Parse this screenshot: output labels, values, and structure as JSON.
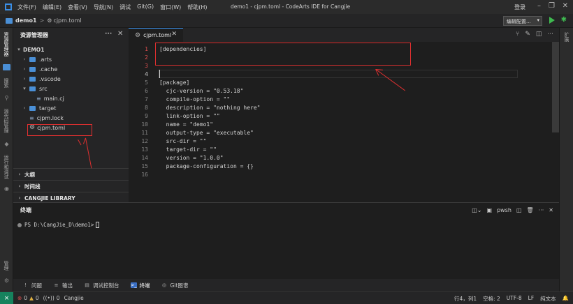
{
  "menu": [
    "文件(F)",
    "编辑(E)",
    "查看(V)",
    "导航(N)",
    "调试",
    "Git(G)",
    "窗口(W)",
    "帮助(H)"
  ],
  "window_title": "demo1 - cjpm.toml - CodeArts IDE for Cangjie",
  "login": "登录",
  "breadcrumb": {
    "project": "demo1",
    "separator": ">",
    "file": "cjpm.toml"
  },
  "toolbar": {
    "config_select": "编辑配置...",
    "run_icon": "play-icon",
    "debug_icon": "bug-icon"
  },
  "activity": {
    "explorer": "资源管理器",
    "search": "搜索",
    "source_control": "源代码管理",
    "run_debug": "运行和调试",
    "manage": "管理"
  },
  "rightbar": {
    "extensions": "扩展"
  },
  "sidebar": {
    "title": "资源管理器",
    "more": "···",
    "root": "DEMO1",
    "tree": [
      {
        "label": ".arts",
        "type": "folder",
        "expanded": false,
        "indent": 1
      },
      {
        "label": ".cache",
        "type": "folder",
        "expanded": false,
        "indent": 1
      },
      {
        "label": ".vscode",
        "type": "folder",
        "expanded": false,
        "indent": 1
      },
      {
        "label": "src",
        "type": "folder",
        "expanded": true,
        "indent": 1
      },
      {
        "label": "main.cj",
        "type": "file",
        "indent": 2
      },
      {
        "label": "target",
        "type": "folder",
        "expanded": false,
        "indent": 1
      },
      {
        "label": "cjpm.lock",
        "type": "file",
        "indent": 1
      },
      {
        "label": "cjpm.toml",
        "type": "gear-file",
        "indent": 1
      }
    ],
    "sections": [
      "大纲",
      "时间线",
      "CANGJIE LIBRARY"
    ]
  },
  "editor": {
    "tab": "cjpm.toml",
    "lines": [
      {
        "n": "1",
        "text": "[dependencies]",
        "err": true
      },
      {
        "n": "2",
        "text": "",
        "err": true
      },
      {
        "n": "3",
        "text": "",
        "err": true
      },
      {
        "n": "4",
        "text": "",
        "cur": true
      },
      {
        "n": "5",
        "text": "[package]"
      },
      {
        "n": "6",
        "text": "  cjc-version = \"0.53.18\""
      },
      {
        "n": "7",
        "text": "  compile-option = \"\""
      },
      {
        "n": "8",
        "text": "  description = \"nothing here\""
      },
      {
        "n": "9",
        "text": "  link-option = \"\""
      },
      {
        "n": "10",
        "text": "  name = \"demo1\""
      },
      {
        "n": "11",
        "text": "  output-type = \"executable\""
      },
      {
        "n": "12",
        "text": "  src-dir = \"\""
      },
      {
        "n": "13",
        "text": "  target-dir = \"\""
      },
      {
        "n": "14",
        "text": "  version = \"1.0.0\""
      },
      {
        "n": "15",
        "text": "  package-configuration = {}"
      },
      {
        "n": "16",
        "text": ""
      }
    ]
  },
  "panel": {
    "title": "终端",
    "shell": "pwsh",
    "prompt": "PS D:\\CangJie_D\\demo1> "
  },
  "bottom_tabs": [
    {
      "label": "问题",
      "icon": "!",
      "active": false
    },
    {
      "label": "输出",
      "icon": "≡",
      "active": false
    },
    {
      "label": "调试控制台",
      "icon": "▤",
      "active": false
    },
    {
      "label": "终端",
      "icon": ">_",
      "active": true
    },
    {
      "label": "Git图谱",
      "icon": "◎",
      "active": false
    }
  ],
  "status": {
    "errors": "0",
    "warnings": "0",
    "info": "0",
    "lang": "Cangjie",
    "position": "行4，列1",
    "spaces": "空格: 2",
    "encoding": "UTF-8",
    "eol": "LF",
    "mode": "纯文本"
  }
}
